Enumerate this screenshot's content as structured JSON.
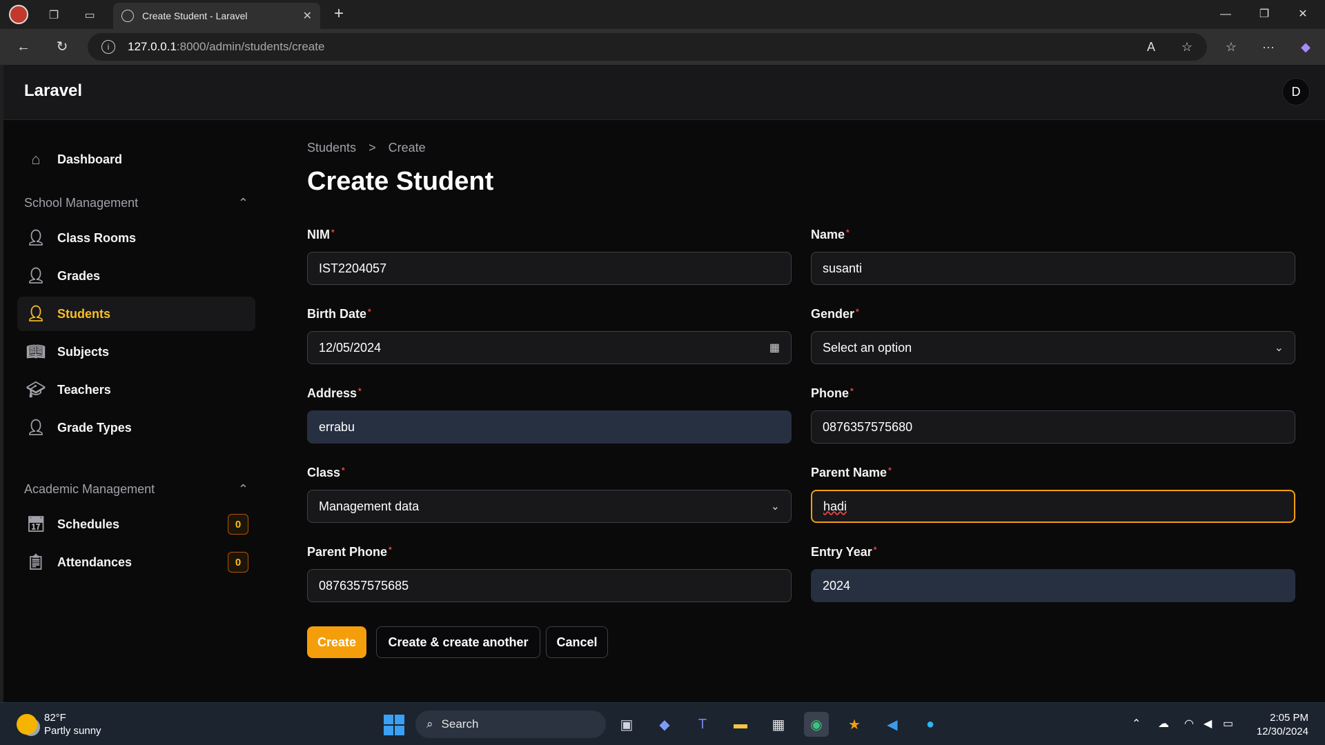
{
  "browser": {
    "tab_title": "Create Student - Laravel",
    "url_host": "127.0.0.1",
    "url_path": ":8000/admin/students/create"
  },
  "app": {
    "brand": "Laravel",
    "user_initial": "D"
  },
  "sidebar": {
    "dashboard": "Dashboard",
    "group1": "School Management",
    "items1": [
      {
        "label": "Class Rooms",
        "icon": "user-icon"
      },
      {
        "label": "Grades",
        "icon": "user-icon"
      },
      {
        "label": "Students",
        "icon": "user-icon",
        "active": true
      },
      {
        "label": "Subjects",
        "icon": "book-icon"
      },
      {
        "label": "Teachers",
        "icon": "graduation-cap-icon"
      },
      {
        "label": "Grade Types",
        "icon": "user-icon"
      }
    ],
    "group2": "Academic Management",
    "items2": [
      {
        "label": "Schedules",
        "icon": "calendar-icon",
        "badge": "0"
      },
      {
        "label": "Attendances",
        "icon": "clipboard-check-icon",
        "badge": "0"
      }
    ]
  },
  "page": {
    "breadcrumb_parent": "Students",
    "breadcrumb_sep": ">",
    "breadcrumb_current": "Create",
    "title": "Create Student"
  },
  "form": {
    "nim_label": "NIM",
    "nim_value": "IST2204057",
    "name_label": "Name",
    "name_value": "susanti",
    "birth_label": "Birth Date",
    "birth_value": "12/05/2024",
    "gender_label": "Gender",
    "gender_value": "Select an option",
    "address_label": "Address",
    "address_value": "errabu",
    "phone_label": "Phone",
    "phone_value": "0876357575680",
    "class_label": "Class",
    "class_value": "Management data",
    "parent_name_label": "Parent Name",
    "parent_name_value": "hadi",
    "parent_phone_label": "Parent Phone",
    "parent_phone_value": "0876357575685",
    "entry_year_label": "Entry Year",
    "entry_year_value": "2024",
    "required_mark": "*"
  },
  "actions": {
    "create": "Create",
    "create_another": "Create & create another",
    "cancel": "Cancel"
  },
  "taskbar": {
    "temp": "82°F",
    "weather": "Partly sunny",
    "search": "Search",
    "time": "2:05 PM",
    "date": "12/30/2024"
  },
  "colors": {
    "accent": "#f59e0b",
    "required": "#ef4444"
  }
}
